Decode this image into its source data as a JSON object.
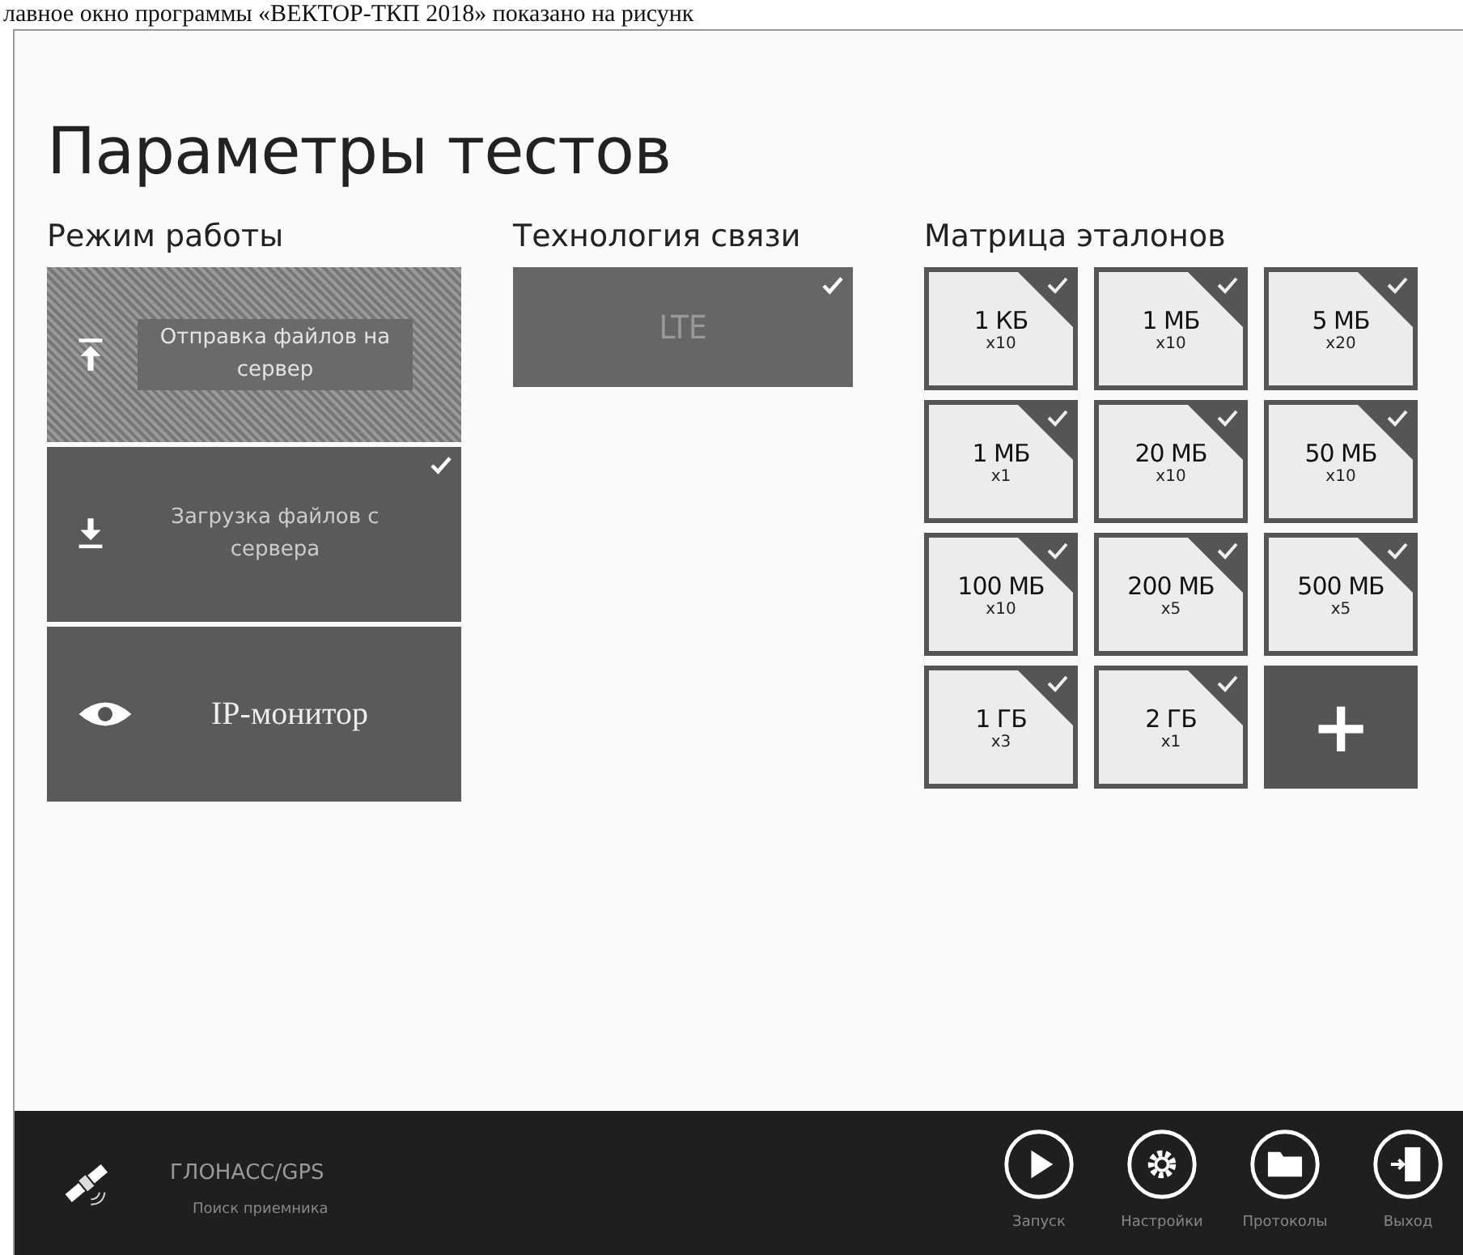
{
  "caption": "лавное окно программы «ВЕКТОР-ТКП 2018» показано на рисунк",
  "title": "Параметры тестов",
  "modes": {
    "heading": "Режим работы",
    "items": [
      {
        "label": "Отправка файлов на сервер",
        "disabled": true,
        "selected": false
      },
      {
        "label": "Загрузка файлов с сервера",
        "disabled": false,
        "selected": true
      },
      {
        "label": "IP-монитор",
        "disabled": false,
        "selected": false
      }
    ]
  },
  "technology": {
    "heading": "Технология связи",
    "items": [
      {
        "label": "LTE",
        "selected": true
      }
    ]
  },
  "matrix": {
    "heading": "Матрица эталонов",
    "items": [
      {
        "kind": "size",
        "size": "1 КБ",
        "count": "x10",
        "selected": true
      },
      {
        "kind": "size",
        "size": "1 МБ",
        "count": "x10",
        "selected": true
      },
      {
        "kind": "size",
        "size": "5 МБ",
        "count": "x20",
        "selected": true
      },
      {
        "kind": "size",
        "size": "1 МБ",
        "count": "x1",
        "selected": true
      },
      {
        "kind": "size",
        "size": "20 МБ",
        "count": "x10",
        "selected": true
      },
      {
        "kind": "size",
        "size": "50 МБ",
        "count": "x10",
        "selected": true
      },
      {
        "kind": "size",
        "size": "100 МБ",
        "count": "x10",
        "selected": true
      },
      {
        "kind": "size",
        "size": "200 МБ",
        "count": "x5",
        "selected": true
      },
      {
        "kind": "size",
        "size": "500 МБ",
        "count": "x5",
        "selected": true
      },
      {
        "kind": "size",
        "size": "1 ГБ",
        "count": "x3",
        "selected": true
      },
      {
        "kind": "size",
        "size": "2 ГБ",
        "count": "x1",
        "selected": true
      },
      {
        "kind": "add",
        "label": "+"
      }
    ]
  },
  "status": {
    "name": "ГЛОНАСС/GPS",
    "state": "Поиск приемника"
  },
  "actions": [
    {
      "label": "Запуск"
    },
    {
      "label": "Настройки"
    },
    {
      "label": "Протоколы"
    },
    {
      "label": "Выход"
    }
  ]
}
